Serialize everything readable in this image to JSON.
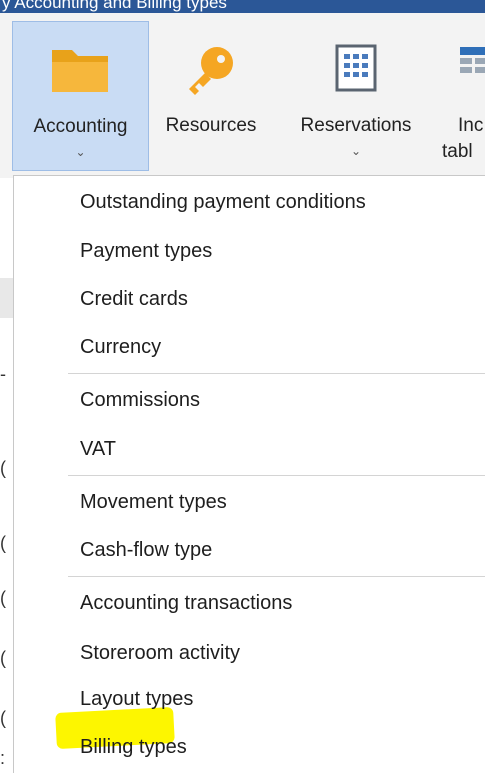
{
  "titlebar": {
    "text": "y Accounting and Billing types"
  },
  "ribbon": {
    "buttons": [
      {
        "label": "Accounting",
        "icon": "folder-icon",
        "dropdown": true,
        "active": true
      },
      {
        "label": "Resources",
        "icon": "key-icon",
        "dropdown": false
      },
      {
        "label": "Reservations",
        "icon": "calendar-icon",
        "dropdown": true
      },
      {
        "label_line1": "Inc",
        "label_line2": "tabl",
        "icon": "table-icon"
      }
    ]
  },
  "menu": {
    "items": [
      "Outstanding payment conditions",
      "Payment types",
      "Credit cards",
      "Currency",
      "Commissions",
      "VAT",
      "Movement types",
      "Cash-flow type",
      "Accounting transactions",
      "Storeroom activity",
      "Layout types",
      "Billing types"
    ],
    "highlighted_item": "Billing types",
    "highlight_color": "#fdf600"
  },
  "colors": {
    "accent": "#2b5797",
    "active_button": "#c9dcf4"
  }
}
